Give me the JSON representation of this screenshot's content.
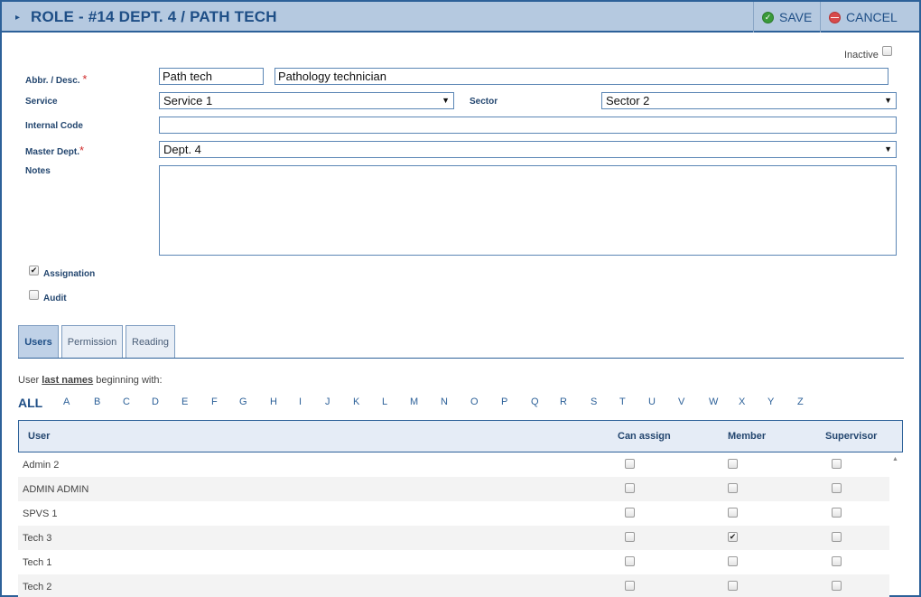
{
  "window": {
    "title": "ROLE - #14 DEPT. 4 / PATH TECH",
    "save_label": "SAVE",
    "cancel_label": "CANCEL"
  },
  "form": {
    "inactive_label": "Inactive",
    "inactive_checked": false,
    "abbr_desc_label": "Abbr. / Desc.",
    "abbr_value": "Path tech",
    "desc_value": "Pathology technician",
    "service_label": "Service",
    "service_value": "Service 1",
    "sector_label": "Sector",
    "sector_value": "Sector 2",
    "internal_code_label": "Internal Code",
    "internal_code_value": "",
    "master_dept_label": "Master Dept.",
    "master_dept_value": "Dept. 4",
    "notes_label": "Notes",
    "notes_value": "",
    "assignation_label": "Assignation",
    "assignation_checked": true,
    "audit_label": "Audit",
    "audit_checked": false,
    "required_mark": "*"
  },
  "tabs": [
    {
      "label": "Users",
      "active": true
    },
    {
      "label": "Permission",
      "active": false
    },
    {
      "label": "Reading",
      "active": false
    }
  ],
  "filter": {
    "caption_prefix": "User ",
    "caption_link": "last names",
    "caption_suffix": " beginning with:",
    "letters": [
      "ALL",
      "A",
      "B",
      "C",
      "D",
      "E",
      "F",
      "G",
      "H",
      "I",
      "J",
      "K",
      "L",
      "M",
      "N",
      "O",
      "P",
      "Q",
      "R",
      "S",
      "T",
      "U",
      "V",
      "W",
      "X",
      "Y",
      "Z"
    ]
  },
  "grid": {
    "columns": [
      "User",
      "Can assign",
      "Member",
      "Supervisor"
    ],
    "rows": [
      {
        "user": "Admin 2",
        "can_assign": false,
        "member": false,
        "supervisor": false
      },
      {
        "user": "ADMIN ADMIN",
        "can_assign": false,
        "member": false,
        "supervisor": false
      },
      {
        "user": "SPVS 1",
        "can_assign": false,
        "member": false,
        "supervisor": false
      },
      {
        "user": "Tech 3",
        "can_assign": false,
        "member": true,
        "supervisor": false
      },
      {
        "user": "Tech 1",
        "can_assign": false,
        "member": false,
        "supervisor": false
      },
      {
        "user": "Tech 2",
        "can_assign": false,
        "member": false,
        "supervisor": false
      }
    ]
  },
  "colors": {
    "accent": "#2d6199",
    "titlebar": "#b5c9e0",
    "required": "#d12c2c"
  },
  "icons": {
    "title": "chevron-right-icon",
    "save": "check-circle-icon",
    "cancel": "minus-circle-icon",
    "checked": "check-mark",
    "select": "caret-down-icon",
    "scroll": "scroll-up-arrow-icon"
  }
}
